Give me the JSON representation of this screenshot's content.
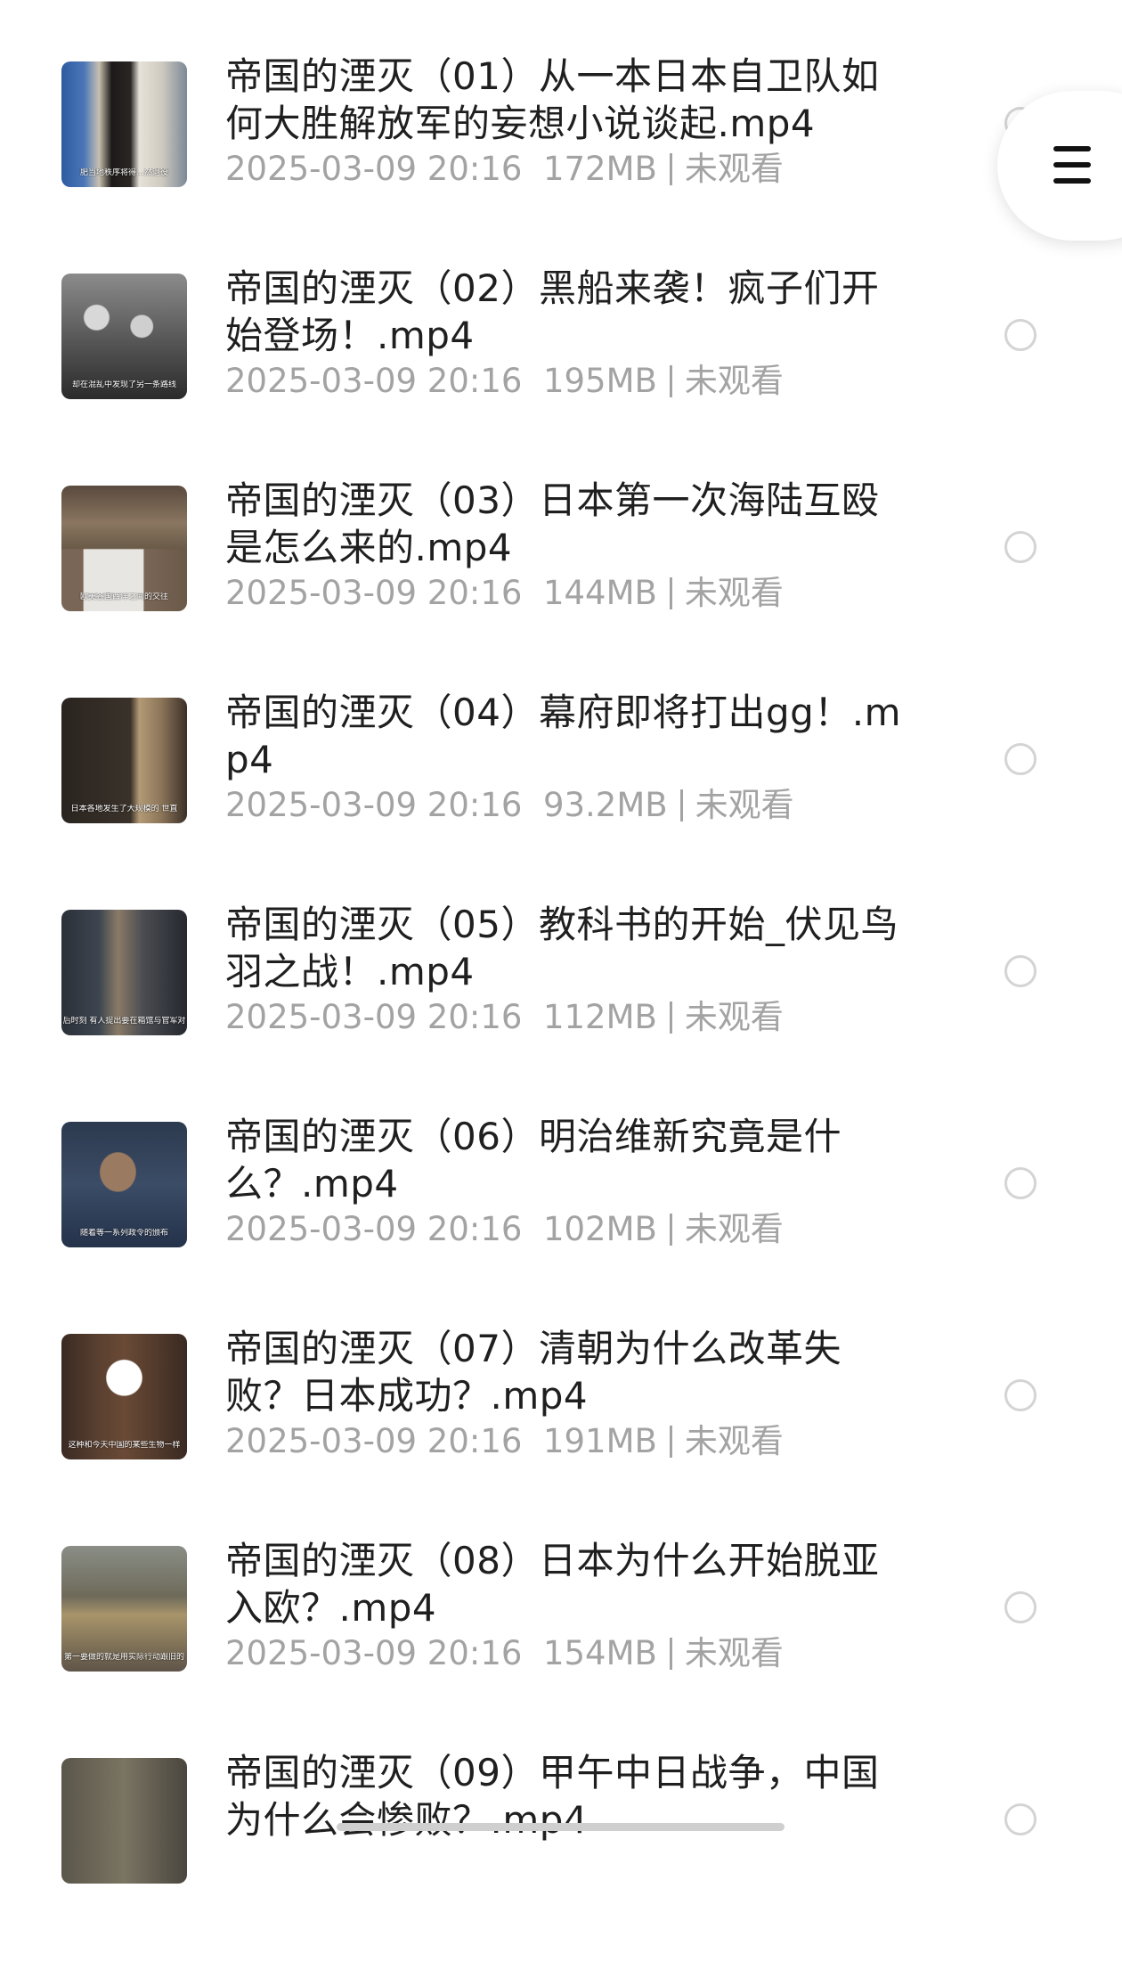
{
  "videos": [
    {
      "title": "帝国的湮灭（01）从一本日本自卫队如何大胜解放军的妄想小说谈起.mp4",
      "date": "2025-03-09 20:16",
      "size": "172MB",
      "status": "未观看",
      "thumb_caption": "肥当地秩序将得…然退役"
    },
    {
      "title": "帝国的湮灭（02）黑船来袭！疯子们开始登场！.mp4",
      "date": "2025-03-09 20:16",
      "size": "195MB",
      "status": "未观看",
      "thumb_caption": "却在混乱中发现了另一条路线"
    },
    {
      "title": "帝国的湮灭（03）日本第一次海陆互殴是怎么来的.mp4",
      "date": "2025-03-09 20:16",
      "size": "144MB",
      "status": "未观看",
      "thumb_caption": "欧美各国西洋之间的交往"
    },
    {
      "title": "帝国的湮灭（04）幕府即将打出gg！.mp4",
      "date": "2025-03-09 20:16",
      "size": "93.2MB",
      "status": "未观看",
      "thumb_caption": "日本各地发生了大规模的 世直"
    },
    {
      "title": "帝国的湮灭（05）教科书的开始_伏见鸟羽之战！.mp4",
      "date": "2025-03-09 20:16",
      "size": "112MB",
      "status": "未观看",
      "thumb_caption": "后时刻 有人提出要在箱馆与官军对"
    },
    {
      "title": "帝国的湮灭（06）明治维新究竟是什么？.mp4",
      "date": "2025-03-09 20:16",
      "size": "102MB",
      "status": "未观看",
      "thumb_caption": "随着等一系列政令的颁布"
    },
    {
      "title": "帝国的湮灭（07）清朝为什么改革失败？日本成功？.mp4",
      "date": "2025-03-09 20:16",
      "size": "191MB",
      "status": "未观看",
      "thumb_caption": "这种和今天中国的某些生物一样"
    },
    {
      "title": "帝国的湮灭（08）日本为什么开始脱亚入欧？.mp4",
      "date": "2025-03-09 20:16",
      "size": "154MB",
      "status": "未观看",
      "thumb_caption": "第一要做的就是用实际行动跟旧的"
    },
    {
      "title": "帝国的湮灭（09）甲午中日战争，中国为什么会惨败？.mp4",
      "date": "",
      "size": "",
      "status": "",
      "thumb_caption": ""
    }
  ],
  "menu_icon": "hamburger-menu-icon",
  "colors": {
    "title": "#1f1f1f",
    "meta": "#a3a3a3",
    "radio_border": "#d4d4d4",
    "background": "#ffffff"
  }
}
